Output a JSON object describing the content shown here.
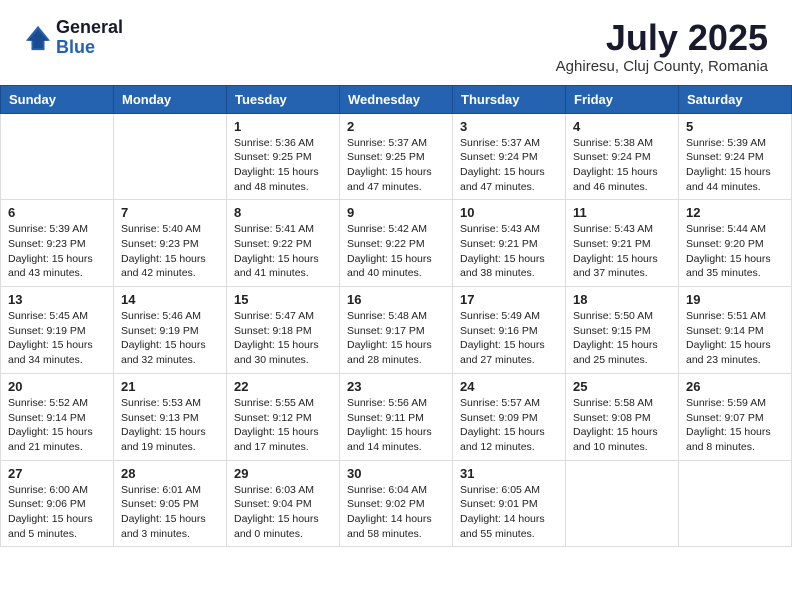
{
  "logo": {
    "general": "General",
    "blue": "Blue"
  },
  "title": {
    "month_year": "July 2025",
    "location": "Aghiresu, Cluj County, Romania"
  },
  "weekdays": [
    "Sunday",
    "Monday",
    "Tuesday",
    "Wednesday",
    "Thursday",
    "Friday",
    "Saturday"
  ],
  "weeks": [
    [
      {
        "day": "",
        "sunrise": "",
        "sunset": "",
        "daylight": ""
      },
      {
        "day": "",
        "sunrise": "",
        "sunset": "",
        "daylight": ""
      },
      {
        "day": "1",
        "sunrise": "Sunrise: 5:36 AM",
        "sunset": "Sunset: 9:25 PM",
        "daylight": "Daylight: 15 hours and 48 minutes."
      },
      {
        "day": "2",
        "sunrise": "Sunrise: 5:37 AM",
        "sunset": "Sunset: 9:25 PM",
        "daylight": "Daylight: 15 hours and 47 minutes."
      },
      {
        "day": "3",
        "sunrise": "Sunrise: 5:37 AM",
        "sunset": "Sunset: 9:24 PM",
        "daylight": "Daylight: 15 hours and 47 minutes."
      },
      {
        "day": "4",
        "sunrise": "Sunrise: 5:38 AM",
        "sunset": "Sunset: 9:24 PM",
        "daylight": "Daylight: 15 hours and 46 minutes."
      },
      {
        "day": "5",
        "sunrise": "Sunrise: 5:39 AM",
        "sunset": "Sunset: 9:24 PM",
        "daylight": "Daylight: 15 hours and 44 minutes."
      }
    ],
    [
      {
        "day": "6",
        "sunrise": "Sunrise: 5:39 AM",
        "sunset": "Sunset: 9:23 PM",
        "daylight": "Daylight: 15 hours and 43 minutes."
      },
      {
        "day": "7",
        "sunrise": "Sunrise: 5:40 AM",
        "sunset": "Sunset: 9:23 PM",
        "daylight": "Daylight: 15 hours and 42 minutes."
      },
      {
        "day": "8",
        "sunrise": "Sunrise: 5:41 AM",
        "sunset": "Sunset: 9:22 PM",
        "daylight": "Daylight: 15 hours and 41 minutes."
      },
      {
        "day": "9",
        "sunrise": "Sunrise: 5:42 AM",
        "sunset": "Sunset: 9:22 PM",
        "daylight": "Daylight: 15 hours and 40 minutes."
      },
      {
        "day": "10",
        "sunrise": "Sunrise: 5:43 AM",
        "sunset": "Sunset: 9:21 PM",
        "daylight": "Daylight: 15 hours and 38 minutes."
      },
      {
        "day": "11",
        "sunrise": "Sunrise: 5:43 AM",
        "sunset": "Sunset: 9:21 PM",
        "daylight": "Daylight: 15 hours and 37 minutes."
      },
      {
        "day": "12",
        "sunrise": "Sunrise: 5:44 AM",
        "sunset": "Sunset: 9:20 PM",
        "daylight": "Daylight: 15 hours and 35 minutes."
      }
    ],
    [
      {
        "day": "13",
        "sunrise": "Sunrise: 5:45 AM",
        "sunset": "Sunset: 9:19 PM",
        "daylight": "Daylight: 15 hours and 34 minutes."
      },
      {
        "day": "14",
        "sunrise": "Sunrise: 5:46 AM",
        "sunset": "Sunset: 9:19 PM",
        "daylight": "Daylight: 15 hours and 32 minutes."
      },
      {
        "day": "15",
        "sunrise": "Sunrise: 5:47 AM",
        "sunset": "Sunset: 9:18 PM",
        "daylight": "Daylight: 15 hours and 30 minutes."
      },
      {
        "day": "16",
        "sunrise": "Sunrise: 5:48 AM",
        "sunset": "Sunset: 9:17 PM",
        "daylight": "Daylight: 15 hours and 28 minutes."
      },
      {
        "day": "17",
        "sunrise": "Sunrise: 5:49 AM",
        "sunset": "Sunset: 9:16 PM",
        "daylight": "Daylight: 15 hours and 27 minutes."
      },
      {
        "day": "18",
        "sunrise": "Sunrise: 5:50 AM",
        "sunset": "Sunset: 9:15 PM",
        "daylight": "Daylight: 15 hours and 25 minutes."
      },
      {
        "day": "19",
        "sunrise": "Sunrise: 5:51 AM",
        "sunset": "Sunset: 9:14 PM",
        "daylight": "Daylight: 15 hours and 23 minutes."
      }
    ],
    [
      {
        "day": "20",
        "sunrise": "Sunrise: 5:52 AM",
        "sunset": "Sunset: 9:14 PM",
        "daylight": "Daylight: 15 hours and 21 minutes."
      },
      {
        "day": "21",
        "sunrise": "Sunrise: 5:53 AM",
        "sunset": "Sunset: 9:13 PM",
        "daylight": "Daylight: 15 hours and 19 minutes."
      },
      {
        "day": "22",
        "sunrise": "Sunrise: 5:55 AM",
        "sunset": "Sunset: 9:12 PM",
        "daylight": "Daylight: 15 hours and 17 minutes."
      },
      {
        "day": "23",
        "sunrise": "Sunrise: 5:56 AM",
        "sunset": "Sunset: 9:11 PM",
        "daylight": "Daylight: 15 hours and 14 minutes."
      },
      {
        "day": "24",
        "sunrise": "Sunrise: 5:57 AM",
        "sunset": "Sunset: 9:09 PM",
        "daylight": "Daylight: 15 hours and 12 minutes."
      },
      {
        "day": "25",
        "sunrise": "Sunrise: 5:58 AM",
        "sunset": "Sunset: 9:08 PM",
        "daylight": "Daylight: 15 hours and 10 minutes."
      },
      {
        "day": "26",
        "sunrise": "Sunrise: 5:59 AM",
        "sunset": "Sunset: 9:07 PM",
        "daylight": "Daylight: 15 hours and 8 minutes."
      }
    ],
    [
      {
        "day": "27",
        "sunrise": "Sunrise: 6:00 AM",
        "sunset": "Sunset: 9:06 PM",
        "daylight": "Daylight: 15 hours and 5 minutes."
      },
      {
        "day": "28",
        "sunrise": "Sunrise: 6:01 AM",
        "sunset": "Sunset: 9:05 PM",
        "daylight": "Daylight: 15 hours and 3 minutes."
      },
      {
        "day": "29",
        "sunrise": "Sunrise: 6:03 AM",
        "sunset": "Sunset: 9:04 PM",
        "daylight": "Daylight: 15 hours and 0 minutes."
      },
      {
        "day": "30",
        "sunrise": "Sunrise: 6:04 AM",
        "sunset": "Sunset: 9:02 PM",
        "daylight": "Daylight: 14 hours and 58 minutes."
      },
      {
        "day": "31",
        "sunrise": "Sunrise: 6:05 AM",
        "sunset": "Sunset: 9:01 PM",
        "daylight": "Daylight: 14 hours and 55 minutes."
      },
      {
        "day": "",
        "sunrise": "",
        "sunset": "",
        "daylight": ""
      },
      {
        "day": "",
        "sunrise": "",
        "sunset": "",
        "daylight": ""
      }
    ]
  ]
}
